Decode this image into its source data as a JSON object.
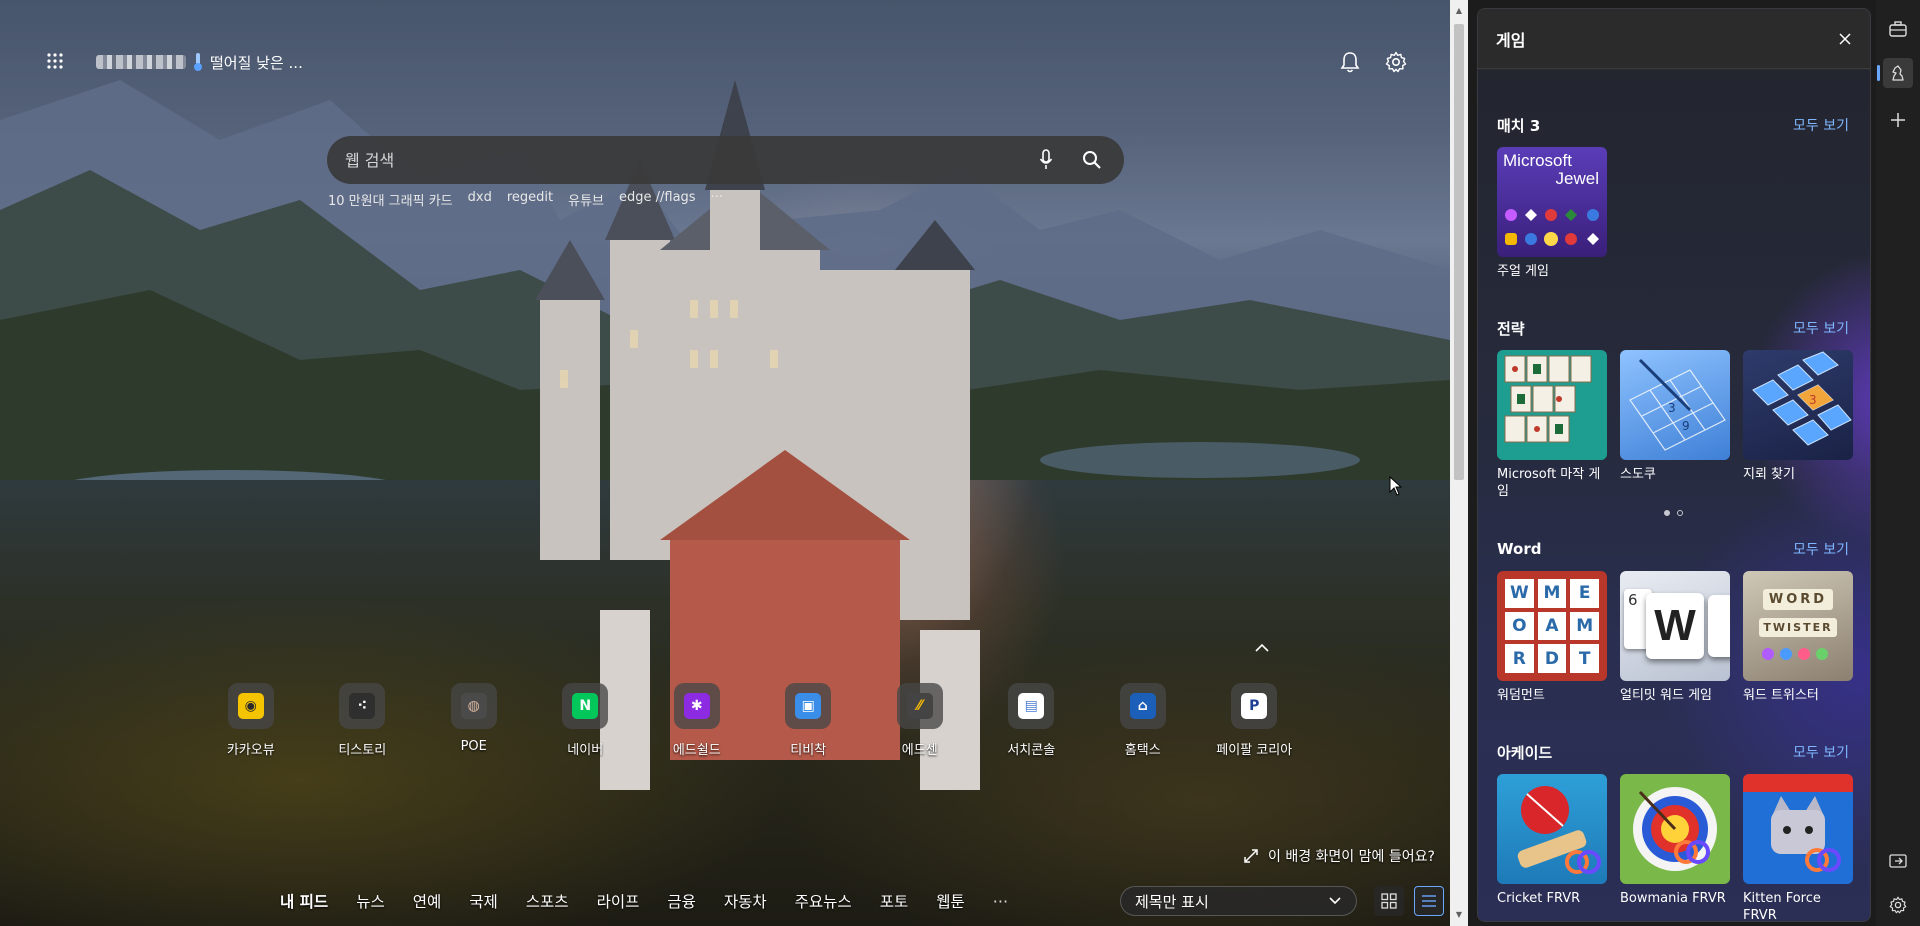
{
  "header": {
    "weather_text": "떨어질 낮은 ..."
  },
  "search": {
    "placeholder": "웹 검색"
  },
  "recent_searches": [
    "10 만원대 그래픽 카드",
    "dxd",
    "regedit",
    "유튜브",
    "edge //flags",
    "···"
  ],
  "quick_links": [
    {
      "label": "카카오뷰",
      "icon": "kakaoview-icon",
      "bg": "#f5c400",
      "fg": "#2b2b2b",
      "glyph": "◉"
    },
    {
      "label": "티스토리",
      "icon": "tistory-icon",
      "bg": "#2f2f2f",
      "fg": "#ffffff",
      "glyph": "⁖"
    },
    {
      "label": "POE",
      "icon": "poe-icon",
      "bg": "#4a4a4a",
      "fg": "#d9b8a0",
      "glyph": "◍"
    },
    {
      "label": "네이버",
      "icon": "naver-icon",
      "bg": "#03c75a",
      "fg": "#ffffff",
      "glyph": "N"
    },
    {
      "label": "에드쉴드",
      "icon": "adshield-icon",
      "bg": "#8c2be2",
      "fg": "#ffffff",
      "glyph": "✱"
    },
    {
      "label": "티비착",
      "icon": "tvchak-icon",
      "bg": "#3b8ee8",
      "fg": "#ffffff",
      "glyph": "▣"
    },
    {
      "label": "에드센",
      "icon": "adsense-icon",
      "bg": "#444444",
      "fg": "#fbbc04",
      "glyph": "⁄⁄"
    },
    {
      "label": "서치콘솔",
      "icon": "searchconsole-icon",
      "bg": "#ffffff",
      "fg": "#4a7bd0",
      "glyph": "▤"
    },
    {
      "label": "홈택스",
      "icon": "hometax-icon",
      "bg": "#1c5fb8",
      "fg": "#ffffff",
      "glyph": "⌂"
    },
    {
      "label": "페이팔 코리아",
      "icon": "paypal-icon",
      "bg": "#ffffff",
      "fg": "#1c3f94",
      "glyph": "P"
    }
  ],
  "background_feedback": "이 배경 화면이 맘에 들어요?",
  "feed_nav": [
    "내 피드",
    "뉴스",
    "연예",
    "국제",
    "스포츠",
    "라이프",
    "금융",
    "자동차",
    "주요뉴스",
    "포토",
    "웹툰"
  ],
  "feed_more": "···",
  "layout_select": {
    "value": "제목만 표시"
  },
  "panel": {
    "title": "게임",
    "see_all": "모두 보기",
    "sections": [
      {
        "title": "매치 3",
        "games": [
          {
            "label": "주얼 게임",
            "art": "jewel",
            "art_text": [
              "Microsoft",
              "Jewel"
            ]
          }
        ]
      },
      {
        "title": "전략",
        "games": [
          {
            "label": "Microsoft 마작 게임",
            "art": "mahjong"
          },
          {
            "label": "스도쿠",
            "art": "sudoku"
          },
          {
            "label": "지뢰 찾기",
            "art": "minesweeper"
          }
        ]
      },
      {
        "title": "Word",
        "games": [
          {
            "label": "워덤먼트",
            "art": "wordament",
            "art_text": [
              "W",
              "M",
              "E",
              "O",
              "A",
              "M",
              "R",
              "D",
              "T"
            ]
          },
          {
            "label": "얼티밋 워드 게임",
            "art": "ultimate-word",
            "art_text": [
              "6",
              "W"
            ]
          },
          {
            "label": "워드 트위스터",
            "art": "word-twister",
            "art_text": [
              "WORD",
              "TWISTER"
            ]
          }
        ]
      },
      {
        "title": "아케이드",
        "games": [
          {
            "label": "Cricket FRVR",
            "art": "cricket"
          },
          {
            "label": "Bowmania FRVR",
            "art": "bowmania"
          },
          {
            "label": "Kitten Force FRVR",
            "art": "kitten"
          }
        ]
      }
    ]
  },
  "colors": {
    "accent": "#7eb6ff",
    "panel_bg": "#2a2b30",
    "sidebar_bg": "#202020"
  }
}
